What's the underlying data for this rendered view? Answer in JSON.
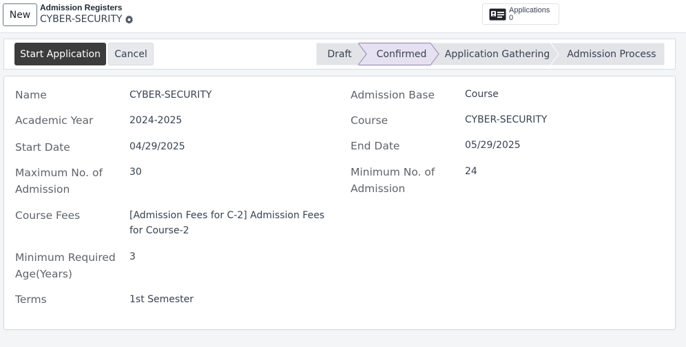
{
  "control_panel": {
    "new_label": "New",
    "breadcrumb_parent": "Admission Registers",
    "breadcrumb_current": "CYBER-SECURITY",
    "smart_button": {
      "label": "Applications",
      "value": "0"
    }
  },
  "statusbar": {
    "start_label": "Start Application",
    "cancel_label": "Cancel",
    "stages": [
      {
        "label": "Draft",
        "active": false
      },
      {
        "label": "Confirmed",
        "active": true
      },
      {
        "label": "Application Gathering",
        "active": false
      },
      {
        "label": "Admission Process",
        "active": false
      }
    ],
    "colors": {
      "stage_bg": "#e2e4e8",
      "stage_active_bg": "#e6e1f0",
      "stage_active_border": "#8b7fae"
    }
  },
  "form": {
    "left": [
      {
        "label": "Name",
        "value": "CYBER-SECURITY"
      },
      {
        "label": "Academic Year",
        "value": "2024-2025"
      },
      {
        "label": "Start Date",
        "value": "04/29/2025"
      },
      {
        "label": "Maximum No. of Admission",
        "value": "30"
      },
      {
        "label": "Course Fees",
        "value": "[Admission Fees for C-2] Admission Fees for Course-2"
      },
      {
        "label": "Minimum Required Age(Years)",
        "value": "3"
      },
      {
        "label": "Terms",
        "value": "1st Semester"
      }
    ],
    "right": [
      {
        "label": "Admission Base",
        "value": "Course"
      },
      {
        "label": "Course",
        "value": "CYBER-SECURITY"
      },
      {
        "label": "End Date",
        "value": "05/29/2025"
      },
      {
        "label": "Minimum No. of Admission",
        "value": "24"
      }
    ]
  }
}
